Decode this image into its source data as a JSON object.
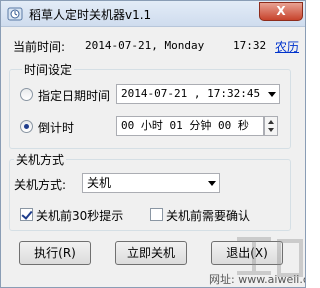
{
  "window": {
    "title": "稻草人定时关机器v1.1",
    "close_label": "X"
  },
  "current_time": {
    "label": "当前时间:",
    "date_value": "2014-07-21, Monday",
    "clock_value": "17:32",
    "lunar_link": "农历"
  },
  "time_settings": {
    "group_title": "时间设定",
    "specific_date": {
      "label": "指定日期时间",
      "value": "2014-07-21 , 17:32:45",
      "checked": false
    },
    "countdown": {
      "label": "倒计时",
      "value": "00 小时 01 分钟 00 秒",
      "checked": true
    }
  },
  "shutdown_mode": {
    "group_title": "关机方式",
    "mode_label": "关机方式:",
    "mode_value": "关机",
    "notify_30s": {
      "label": "关机前30秒提示",
      "checked": true
    },
    "confirm_needed": {
      "label": "关机前需要确认",
      "checked": false
    }
  },
  "buttons": {
    "execute": "执行(R)",
    "shutdown_now": "立即关机",
    "exit": "退出(X)"
  },
  "watermark": {
    "url": "网址: www.aiweii.com"
  }
}
